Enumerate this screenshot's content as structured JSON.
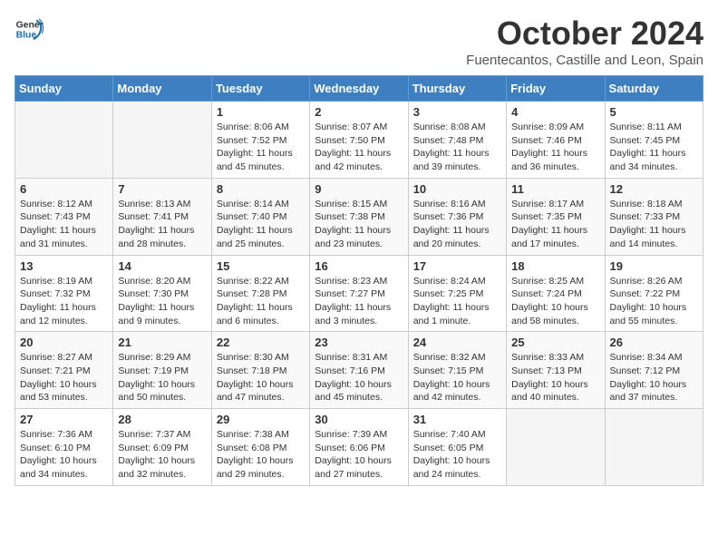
{
  "logo": {
    "line1": "General",
    "line2": "Blue"
  },
  "title": "October 2024",
  "subtitle": "Fuentecantos, Castille and Leon, Spain",
  "headers": [
    "Sunday",
    "Monday",
    "Tuesday",
    "Wednesday",
    "Thursday",
    "Friday",
    "Saturday"
  ],
  "weeks": [
    [
      {
        "day": "",
        "info": ""
      },
      {
        "day": "",
        "info": ""
      },
      {
        "day": "1",
        "info": "Sunrise: 8:06 AM\nSunset: 7:52 PM\nDaylight: 11 hours and 45 minutes."
      },
      {
        "day": "2",
        "info": "Sunrise: 8:07 AM\nSunset: 7:50 PM\nDaylight: 11 hours and 42 minutes."
      },
      {
        "day": "3",
        "info": "Sunrise: 8:08 AM\nSunset: 7:48 PM\nDaylight: 11 hours and 39 minutes."
      },
      {
        "day": "4",
        "info": "Sunrise: 8:09 AM\nSunset: 7:46 PM\nDaylight: 11 hours and 36 minutes."
      },
      {
        "day": "5",
        "info": "Sunrise: 8:11 AM\nSunset: 7:45 PM\nDaylight: 11 hours and 34 minutes."
      }
    ],
    [
      {
        "day": "6",
        "info": "Sunrise: 8:12 AM\nSunset: 7:43 PM\nDaylight: 11 hours and 31 minutes."
      },
      {
        "day": "7",
        "info": "Sunrise: 8:13 AM\nSunset: 7:41 PM\nDaylight: 11 hours and 28 minutes."
      },
      {
        "day": "8",
        "info": "Sunrise: 8:14 AM\nSunset: 7:40 PM\nDaylight: 11 hours and 25 minutes."
      },
      {
        "day": "9",
        "info": "Sunrise: 8:15 AM\nSunset: 7:38 PM\nDaylight: 11 hours and 23 minutes."
      },
      {
        "day": "10",
        "info": "Sunrise: 8:16 AM\nSunset: 7:36 PM\nDaylight: 11 hours and 20 minutes."
      },
      {
        "day": "11",
        "info": "Sunrise: 8:17 AM\nSunset: 7:35 PM\nDaylight: 11 hours and 17 minutes."
      },
      {
        "day": "12",
        "info": "Sunrise: 8:18 AM\nSunset: 7:33 PM\nDaylight: 11 hours and 14 minutes."
      }
    ],
    [
      {
        "day": "13",
        "info": "Sunrise: 8:19 AM\nSunset: 7:32 PM\nDaylight: 11 hours and 12 minutes."
      },
      {
        "day": "14",
        "info": "Sunrise: 8:20 AM\nSunset: 7:30 PM\nDaylight: 11 hours and 9 minutes."
      },
      {
        "day": "15",
        "info": "Sunrise: 8:22 AM\nSunset: 7:28 PM\nDaylight: 11 hours and 6 minutes."
      },
      {
        "day": "16",
        "info": "Sunrise: 8:23 AM\nSunset: 7:27 PM\nDaylight: 11 hours and 3 minutes."
      },
      {
        "day": "17",
        "info": "Sunrise: 8:24 AM\nSunset: 7:25 PM\nDaylight: 11 hours and 1 minute."
      },
      {
        "day": "18",
        "info": "Sunrise: 8:25 AM\nSunset: 7:24 PM\nDaylight: 10 hours and 58 minutes."
      },
      {
        "day": "19",
        "info": "Sunrise: 8:26 AM\nSunset: 7:22 PM\nDaylight: 10 hours and 55 minutes."
      }
    ],
    [
      {
        "day": "20",
        "info": "Sunrise: 8:27 AM\nSunset: 7:21 PM\nDaylight: 10 hours and 53 minutes."
      },
      {
        "day": "21",
        "info": "Sunrise: 8:29 AM\nSunset: 7:19 PM\nDaylight: 10 hours and 50 minutes."
      },
      {
        "day": "22",
        "info": "Sunrise: 8:30 AM\nSunset: 7:18 PM\nDaylight: 10 hours and 47 minutes."
      },
      {
        "day": "23",
        "info": "Sunrise: 8:31 AM\nSunset: 7:16 PM\nDaylight: 10 hours and 45 minutes."
      },
      {
        "day": "24",
        "info": "Sunrise: 8:32 AM\nSunset: 7:15 PM\nDaylight: 10 hours and 42 minutes."
      },
      {
        "day": "25",
        "info": "Sunrise: 8:33 AM\nSunset: 7:13 PM\nDaylight: 10 hours and 40 minutes."
      },
      {
        "day": "26",
        "info": "Sunrise: 8:34 AM\nSunset: 7:12 PM\nDaylight: 10 hours and 37 minutes."
      }
    ],
    [
      {
        "day": "27",
        "info": "Sunrise: 7:36 AM\nSunset: 6:10 PM\nDaylight: 10 hours and 34 minutes."
      },
      {
        "day": "28",
        "info": "Sunrise: 7:37 AM\nSunset: 6:09 PM\nDaylight: 10 hours and 32 minutes."
      },
      {
        "day": "29",
        "info": "Sunrise: 7:38 AM\nSunset: 6:08 PM\nDaylight: 10 hours and 29 minutes."
      },
      {
        "day": "30",
        "info": "Sunrise: 7:39 AM\nSunset: 6:06 PM\nDaylight: 10 hours and 27 minutes."
      },
      {
        "day": "31",
        "info": "Sunrise: 7:40 AM\nSunset: 6:05 PM\nDaylight: 10 hours and 24 minutes."
      },
      {
        "day": "",
        "info": ""
      },
      {
        "day": "",
        "info": ""
      }
    ]
  ]
}
